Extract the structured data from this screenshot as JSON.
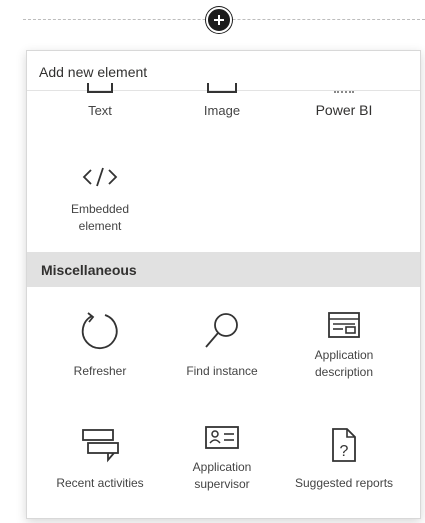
{
  "panel": {
    "title": "Add new element"
  },
  "top_items": [
    {
      "label": "Text",
      "icon": "text-icon"
    },
    {
      "label": "Image",
      "icon": "image-icon"
    },
    {
      "label": "Power BI",
      "icon": "power-bi-icon"
    }
  ],
  "embedded": {
    "label": "Embedded element",
    "icon": "code-icon"
  },
  "misc": {
    "title": "Miscellaneous",
    "items": [
      {
        "label": "Refresher",
        "icon": "refresh-icon"
      },
      {
        "label": "Find instance",
        "icon": "search-icon"
      },
      {
        "label": "Application description",
        "icon": "application-description-icon"
      },
      {
        "label": "Recent activities",
        "icon": "chat-icon"
      },
      {
        "label": "Application supervisor",
        "icon": "contact-card-icon"
      },
      {
        "label": "Suggested reports",
        "icon": "document-question-icon"
      }
    ]
  }
}
